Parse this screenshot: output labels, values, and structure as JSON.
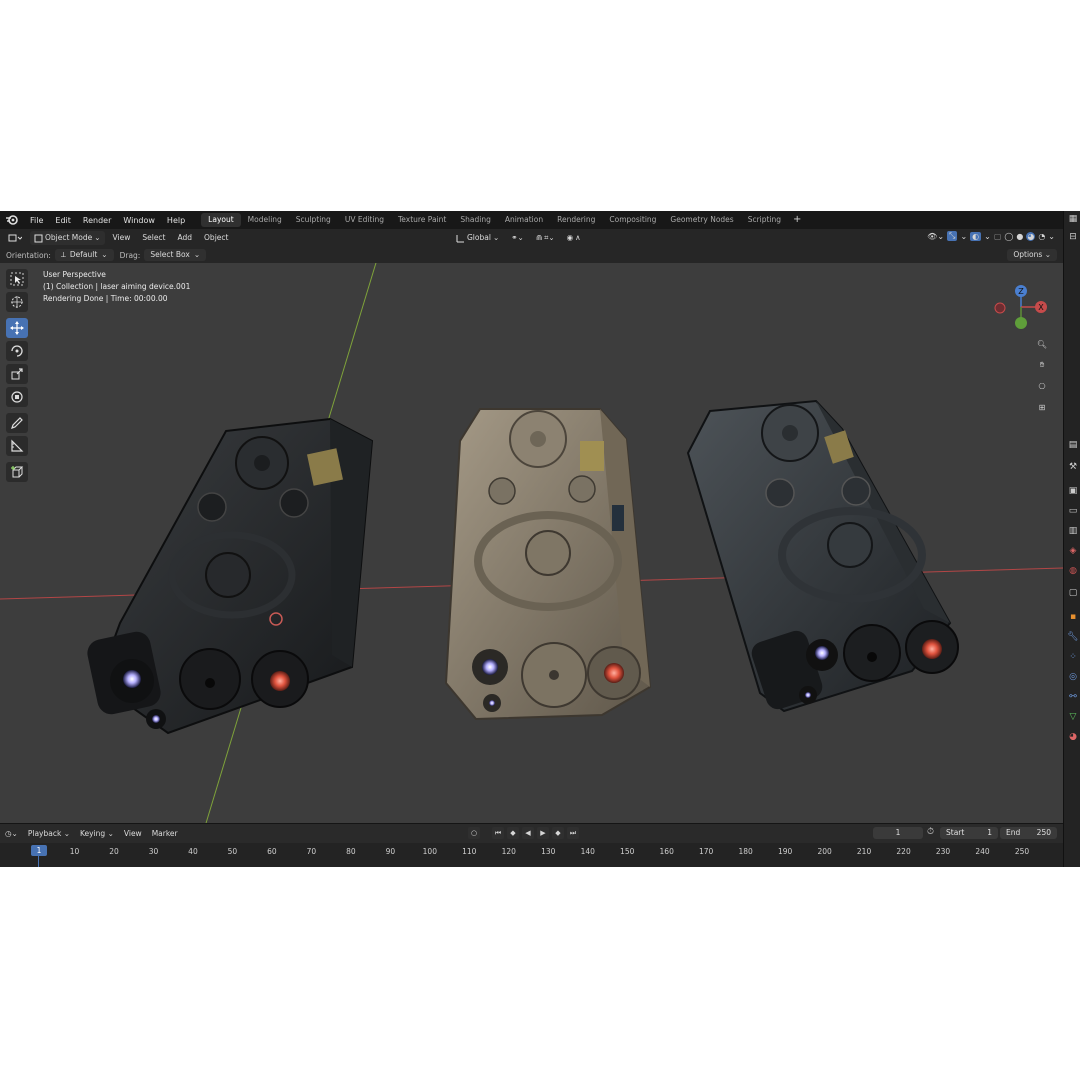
{
  "menu": {
    "items": [
      "File",
      "Edit",
      "Render",
      "Window",
      "Help"
    ]
  },
  "workspaces": {
    "tabs": [
      "Layout",
      "Modeling",
      "Sculpting",
      "UV Editing",
      "Texture Paint",
      "Shading",
      "Animation",
      "Rendering",
      "Compositing",
      "Geometry Nodes",
      "Scripting"
    ],
    "active": "Layout",
    "add_label": "+"
  },
  "header": {
    "mode": "Object Mode",
    "menus": [
      "View",
      "Select",
      "Add",
      "Object"
    ],
    "transform_orientation": "Global"
  },
  "tool_settings": {
    "orientation_label": "Orientation:",
    "orientation_value": "Default",
    "drag_label": "Drag:",
    "drag_value": "Select Box",
    "options_label": "Options"
  },
  "viewport": {
    "overlay_lines": [
      "User Perspective",
      "(1) Collection | laser aiming device.001",
      "Rendering Done | Time: 00:00.00"
    ],
    "gizmo": {
      "z": "Z",
      "x": "X"
    },
    "colors": {
      "background": "#3d3d3d",
      "x_axis": "#b34646",
      "y_axis": "#7ea23a",
      "active_tool": "#4772b3"
    }
  },
  "timeline": {
    "menus": [
      "Playback",
      "Keying",
      "View",
      "Marker"
    ],
    "current_frame": "1",
    "start_label": "Start",
    "start_value": "1",
    "end_label": "End",
    "end_value": "250",
    "ruler_frame": "1",
    "ticks": [
      "10",
      "20",
      "30",
      "40",
      "50",
      "60",
      "70",
      "80",
      "90",
      "100",
      "110",
      "120",
      "130",
      "140",
      "150",
      "160",
      "170",
      "180",
      "190",
      "200",
      "210",
      "220",
      "230",
      "240",
      "250"
    ]
  }
}
